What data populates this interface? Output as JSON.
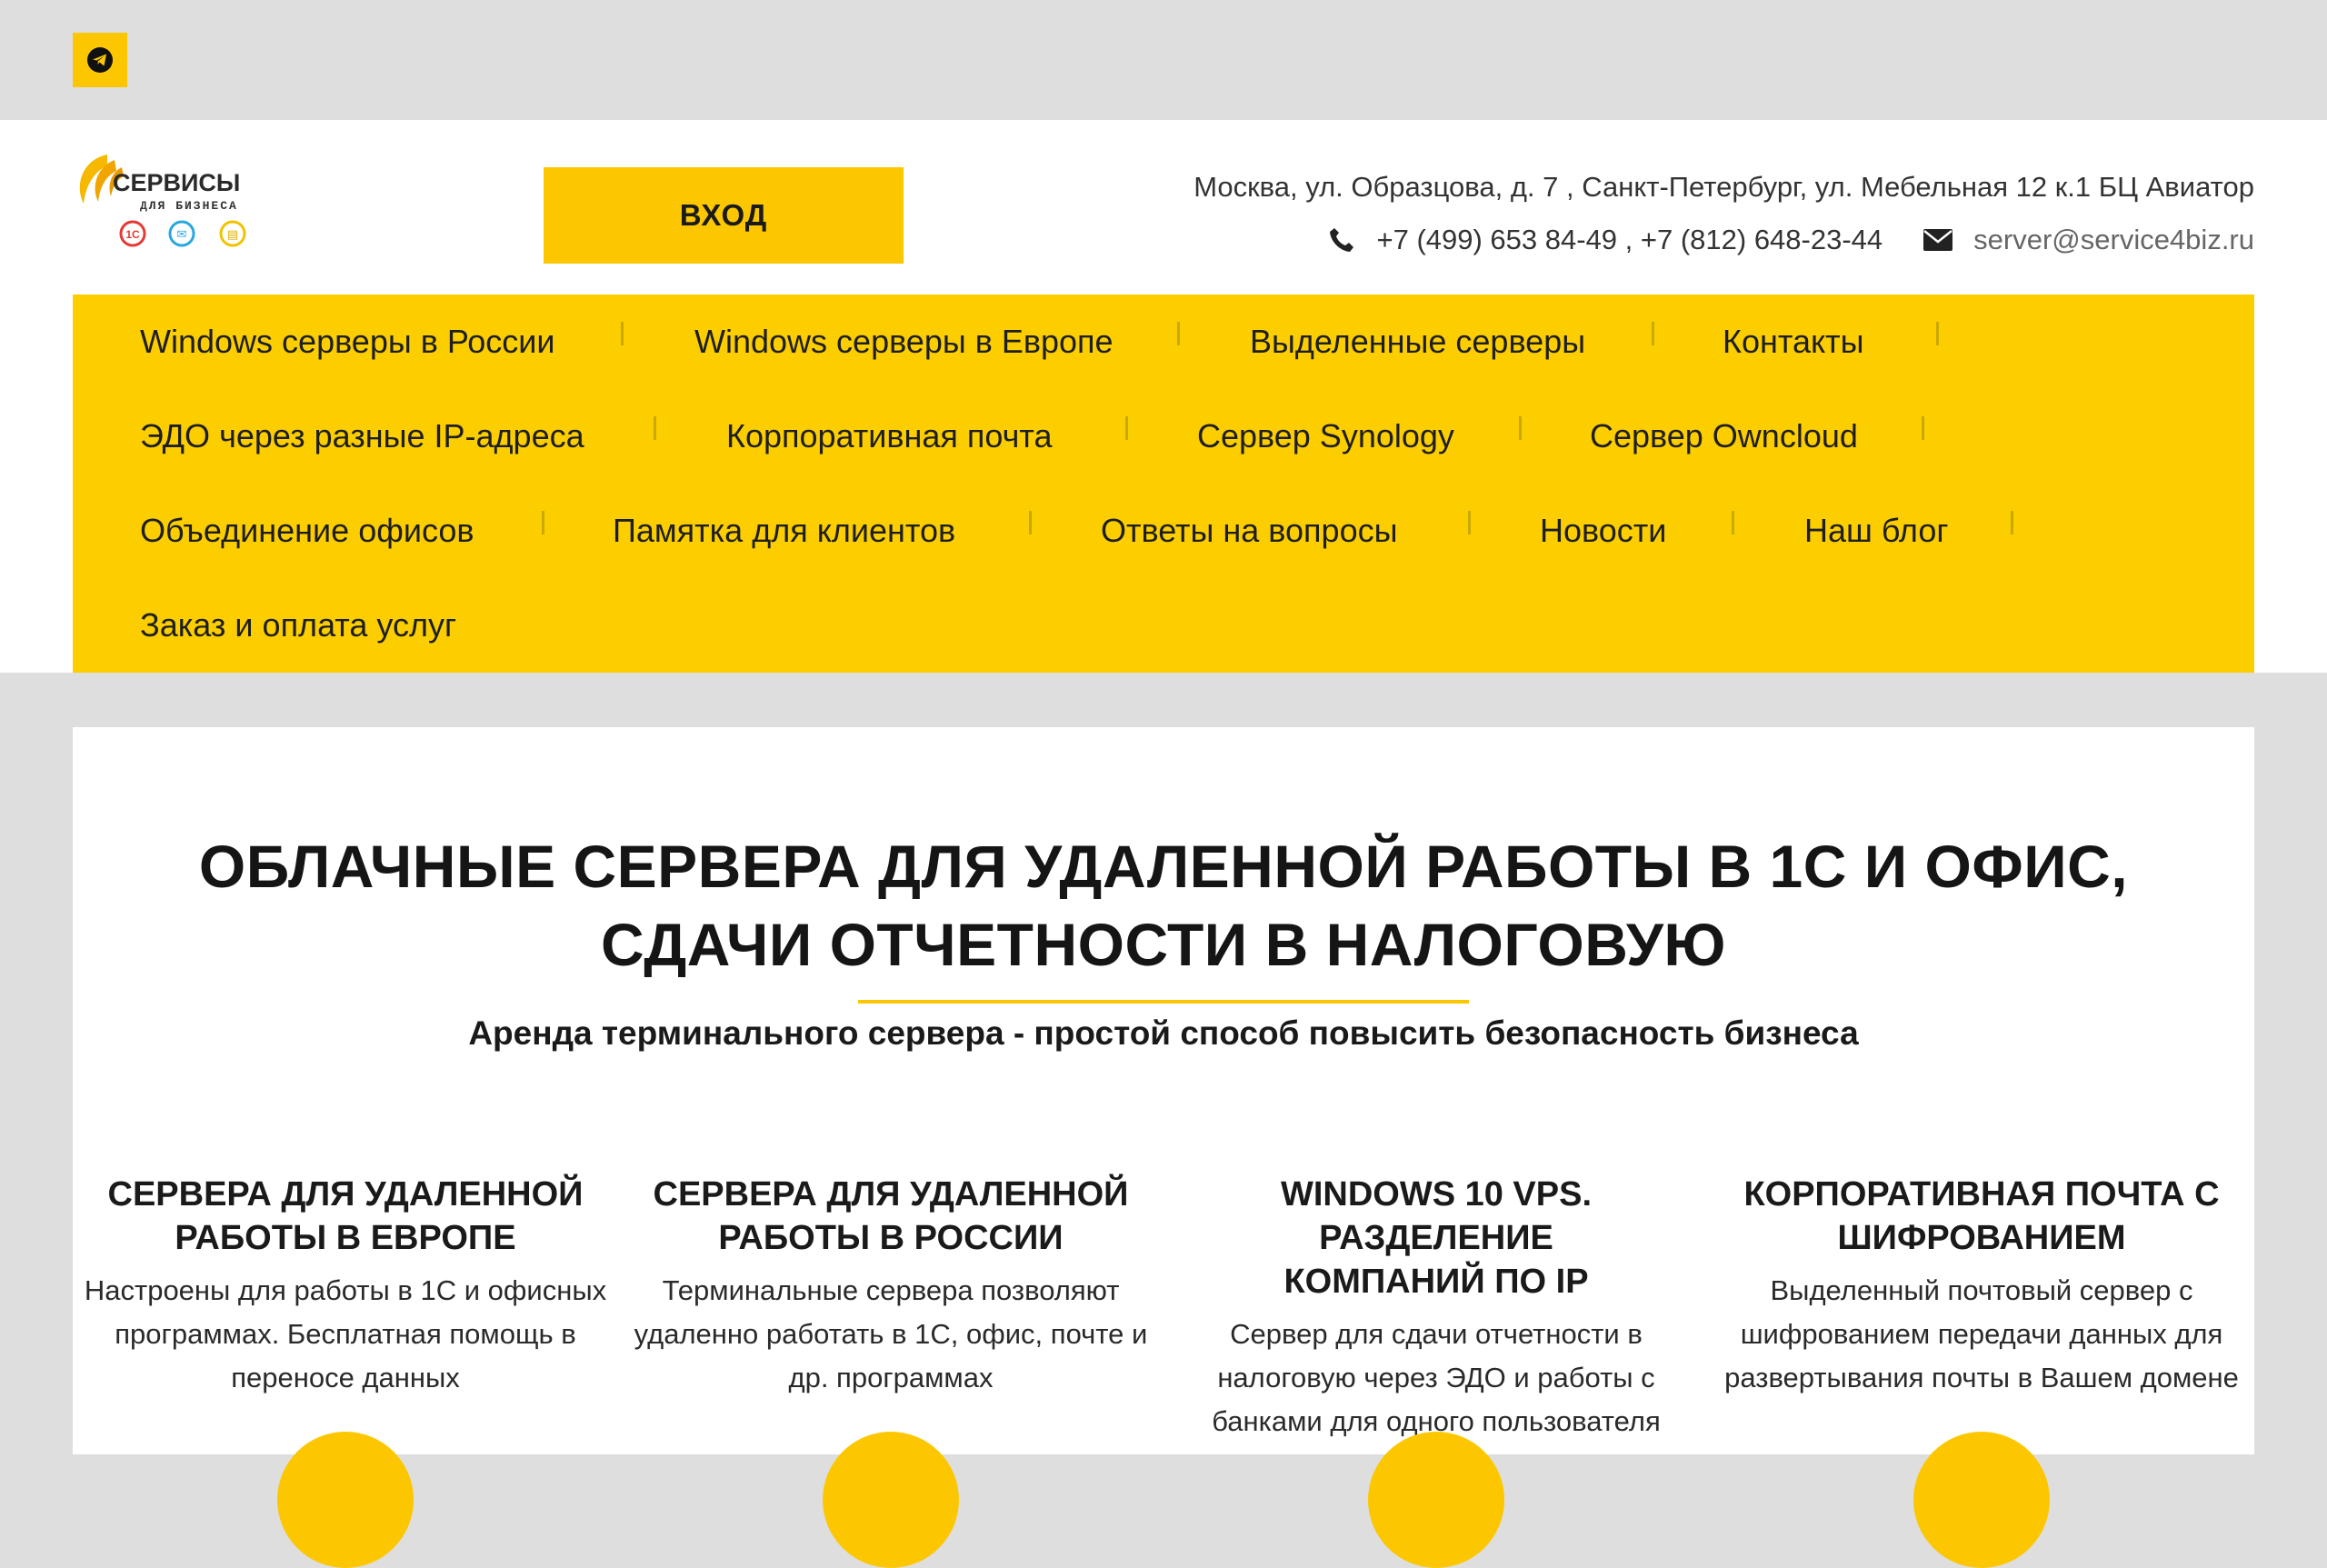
{
  "topbar": {
    "telegram_icon": "telegram-icon"
  },
  "header": {
    "logo": {
      "main": "СЕРВИСЫ",
      "sub": "ДЛЯ БИЗНЕСА",
      "badges": [
        "1С",
        "✉",
        "▤"
      ]
    },
    "login_label": "ВХОД",
    "address": "Москва, ул. Образцова, д. 7 , Санкт-Петербург, ул. Мебельная 12 к.1 БЦ Авиатор",
    "phones": "+7 (499) 653 84-49 , +7 (812) 648-23-44",
    "email": "server@service4biz.ru"
  },
  "nav": {
    "rows": [
      [
        "Windows серверы в России",
        "Windows серверы в Европе",
        "Выделенные серверы",
        "Контакты"
      ],
      [
        "ЭДО через разные IP-адреса",
        "Корпоративная почта",
        "Сервер Synology",
        "Сервер Owncloud"
      ],
      [
        "Объединение офисов",
        "Памятка для клиентов",
        "Ответы на вопросы",
        "Новости",
        "Наш блог"
      ],
      [
        "Заказ и оплата услуг"
      ]
    ]
  },
  "hero": {
    "title_line1": "ОБЛАЧНЫЕ СЕРВЕРА ДЛЯ УДАЛЕННОЙ РАБОТЫ В 1С И ОФИС,",
    "title_line2": "СДАЧИ ОТЧЕТНОСТИ В НАЛОГОВУЮ",
    "subtitle": "Аренда терминального сервера - простой способ повысить безопасность бизнеса"
  },
  "cards": [
    {
      "title1": "СЕРВЕРА ДЛЯ УДАЛЕННОЙ",
      "title2": "РАБОТЫ В ЕВРОПЕ",
      "l1": "Настроены для работы в 1С и офисных",
      "l2": "программах. Бесплатная помощь в",
      "l3": "переносе данных"
    },
    {
      "title1": "СЕРВЕРА ДЛЯ УДАЛЕННОЙ",
      "title2": "РАБОТЫ В РОССИИ",
      "l1": "Терминальные сервера позволяют",
      "l2": "удаленно работать в 1С, офис, почте и",
      "l3": "др. программах"
    },
    {
      "title1": "WINDOWS 10 VPS. РАЗДЕЛЕНИЕ",
      "title2": "КОМПАНИЙ ПО IP",
      "l1": "Сервер для сдачи отчетности в",
      "l2": "налоговую через ЭДО и работы с",
      "l3": "банками для одного пользователя"
    },
    {
      "title1": "КОРПОРАТИВНАЯ ПОЧТА С",
      "title2": "ШИФРОВАНИЕМ",
      "l1": "Выделенный почтовый сервер с",
      "l2": "шифрованием передачи данных для",
      "l3": "развертывания почты в Вашем домене"
    }
  ],
  "colors": {
    "accent": "#fcc700",
    "nav_bg": "#fcce00",
    "page_bg": "#dedede"
  }
}
